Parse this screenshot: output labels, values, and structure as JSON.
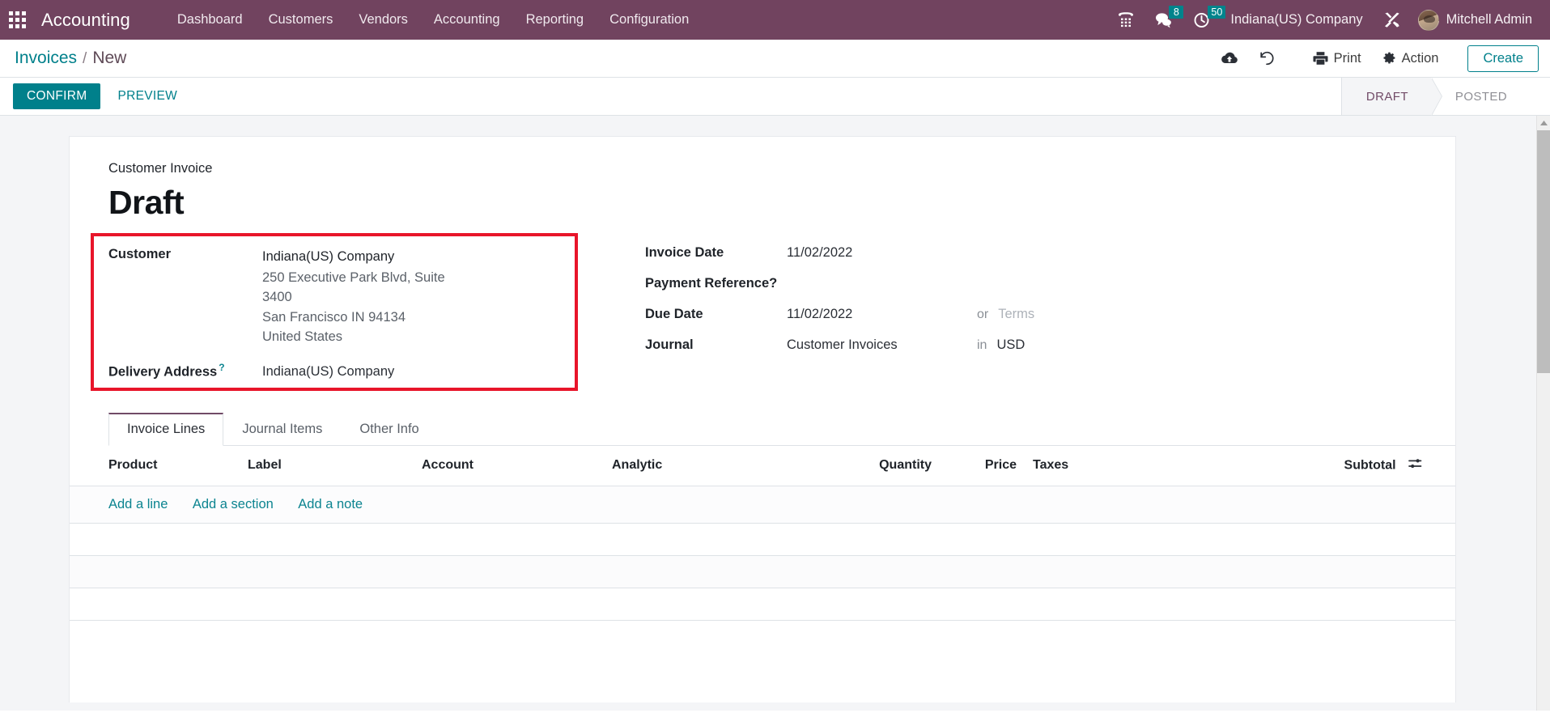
{
  "navbar": {
    "apps_icon": "apps-grid-icon",
    "brand": "Accounting",
    "menu": [
      {
        "label": "Dashboard"
      },
      {
        "label": "Customers"
      },
      {
        "label": "Vendors"
      },
      {
        "label": "Accounting"
      },
      {
        "label": "Reporting"
      },
      {
        "label": "Configuration"
      }
    ],
    "systray": {
      "phone_icon": "phone-dialpad-icon",
      "messages_icon": "chat-bubbles-icon",
      "messages_count": "8",
      "activities_icon": "clock-icon",
      "activities_count": "50",
      "company": "Indiana(US) Company",
      "debug_icon": "tools-wrench-icon",
      "avatar": "user-avatar",
      "user": "Mitchell Admin"
    }
  },
  "control_panel": {
    "breadcrumb": {
      "parent": "Invoices",
      "separator": "/",
      "current": "New"
    },
    "actions": {
      "upload_icon": "cloud-upload-icon",
      "discard_icon": "undo-discard-icon",
      "print_icon": "printer-icon",
      "print_label": "Print",
      "action_icon": "gear-icon",
      "action_label": "Action",
      "create_label": "Create"
    }
  },
  "statusbar_row": {
    "confirm_label": "CONFIRM",
    "preview_label": "PREVIEW",
    "stages": [
      {
        "label": "DRAFT",
        "active": true
      },
      {
        "label": "POSTED",
        "active": false
      }
    ]
  },
  "sheet": {
    "subtitle": "Customer Invoice",
    "title": "Draft",
    "left_fields": {
      "customer_label": "Customer",
      "customer_value": "Indiana(US) Company",
      "customer_address": [
        "250 Executive Park Blvd, Suite 3400",
        "San Francisco IN 94134",
        "United States"
      ],
      "delivery_label": "Delivery Address",
      "delivery_help": "?",
      "delivery_value": "Indiana(US) Company"
    },
    "right_fields": {
      "invoice_date_label": "Invoice Date",
      "invoice_date_value": "11/02/2022",
      "payment_reference_label": "Payment Reference",
      "payment_reference_help": "?",
      "payment_reference_value": "",
      "due_date_label": "Due Date",
      "due_date_value": "11/02/2022",
      "due_date_conj": "or",
      "terms_placeholder": "Terms",
      "journal_label": "Journal",
      "journal_value": "Customer Invoices",
      "journal_conj": "in",
      "currency_value": "USD"
    },
    "tabs": [
      {
        "label": "Invoice Lines",
        "active": true
      },
      {
        "label": "Journal Items",
        "active": false
      },
      {
        "label": "Other Info",
        "active": false
      }
    ],
    "lines_table": {
      "columns": [
        "Product",
        "Label",
        "Account",
        "Analytic",
        "Quantity",
        "Price",
        "Taxes",
        "Subtotal"
      ],
      "optional_columns_icon": "sliders-toggle-icon",
      "rows": [],
      "add_links": [
        "Add a line",
        "Add a section",
        "Add a note"
      ]
    }
  },
  "colors": {
    "navbar_bg": "#71435f",
    "accent_teal": "#00808b",
    "highlight_red": "#e8152a",
    "stage_active": "#714b67",
    "badge_bg": "#00848c"
  }
}
